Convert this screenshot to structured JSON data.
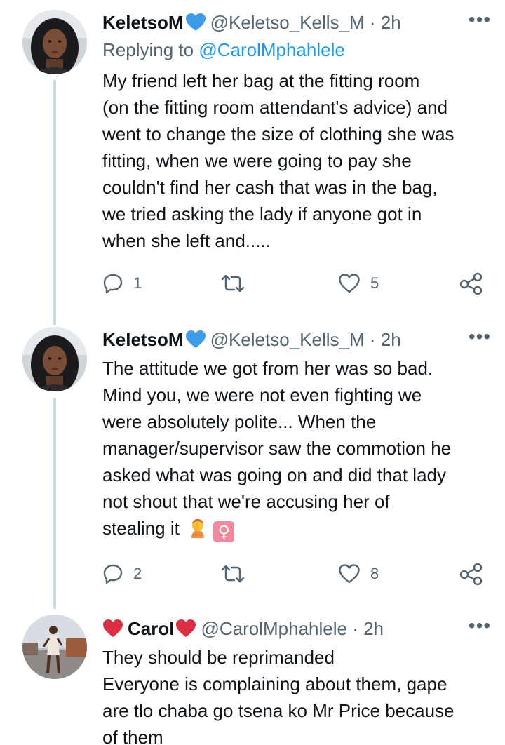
{
  "tweets": [
    {
      "name": "KeletsoM",
      "name_emoji": "blue-heart",
      "handle_time": "@Keletso_Kells_M · 2h",
      "replying_prefix": "Replying to",
      "replying_to": "@CarolMphahlele",
      "lines": [
        "My friend left her bag at the fitting room",
        "(on the fitting room attendant's advice) and",
        "went to change the size of clothing she was",
        "fitting, when we were going to pay she",
        "couldn't find her cash that was in the bag,",
        "we tried asking the lady if anyone got in",
        "when she left and....."
      ],
      "reply_count": "1",
      "retweet_count": "",
      "like_count": "5"
    },
    {
      "name": "KeletsoM",
      "name_emoji": "blue-heart",
      "handle_time": "@Keletso_Kells_M · 2h",
      "lines": [
        "The attitude we got from her was so bad.",
        "Mind you, we were not even fighting we",
        "were absolutely polite... When the",
        "manager/supervisor saw the commotion he",
        "asked what was going on and did that lady",
        "not shout that we're accusing her of",
        "stealing it"
      ],
      "end_emojis": [
        "woman-facepalming",
        "female-sign"
      ],
      "female_sign": "♀",
      "reply_count": "2",
      "retweet_count": "",
      "like_count": "8"
    },
    {
      "name_prefix_emoji": "red-heart",
      "name": "Carol",
      "name_emoji": "red-heart",
      "handle_time": "@CarolMphahlele · 2h",
      "lines": [
        "They should be reprimanded",
        "Everyone is complaining about them, gape",
        "are tlo chaba go tsena ko Mr Price because",
        "of them"
      ]
    }
  ],
  "more_label": "•••",
  "colors": {
    "blue_heart": "#3d9be9",
    "red_heart": "#dd2e44",
    "link": "#1d9bf0",
    "secondary": "#536471",
    "thread_line": "#cfd9de",
    "female_sign_bg": "#f4889c"
  }
}
